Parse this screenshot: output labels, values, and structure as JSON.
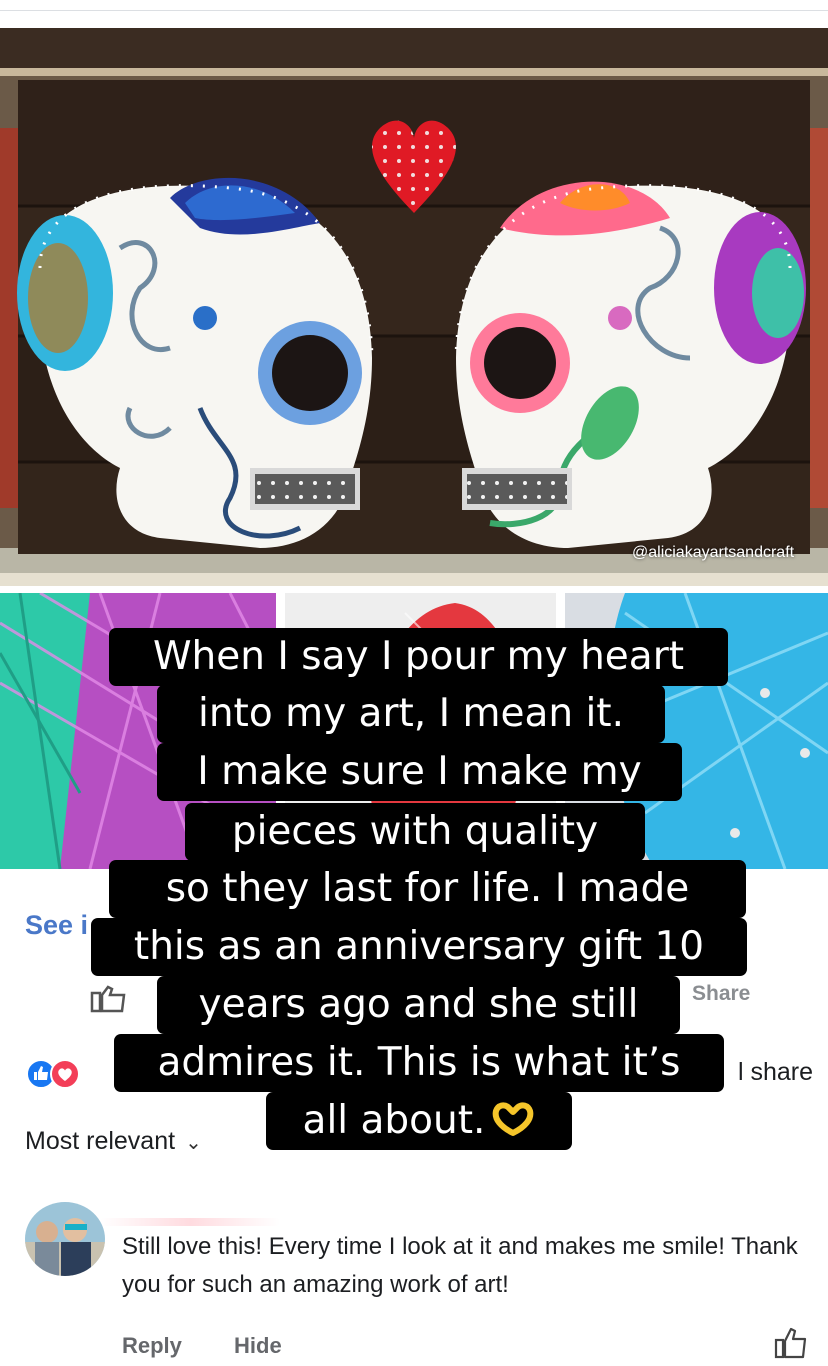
{
  "photo": {
    "watermark": "@aliciakayartsandcraft"
  },
  "post_bar": {
    "see_link": "See i",
    "share_button": "Share",
    "share_count": "l share",
    "reaction_icons": [
      "like-icon",
      "love-icon"
    ]
  },
  "sort": {
    "label": "Most relevant",
    "icon": "chevron-down-icon"
  },
  "comment": {
    "text": "Still love this! Every time I look at it and makes me smile! Thank you for such an amazing work of art!",
    "reply_label": "Reply",
    "hide_label": "Hide"
  },
  "caption": {
    "lines": [
      "When I say I pour my heart",
      "into my art, I mean it.",
      "I make sure I make my",
      "pieces with quality",
      "so they last for life. I made",
      "this as an anniversary gift 10",
      "years ago and she still",
      "admires it. This is what it’s",
      "all about."
    ],
    "emoji_icon": "heart-hands-icon"
  },
  "colors": {
    "link_blue": "#4a78c8",
    "caption_bg": "#000000",
    "caption_text": "#ffffff",
    "muted_text": "#65676b"
  }
}
